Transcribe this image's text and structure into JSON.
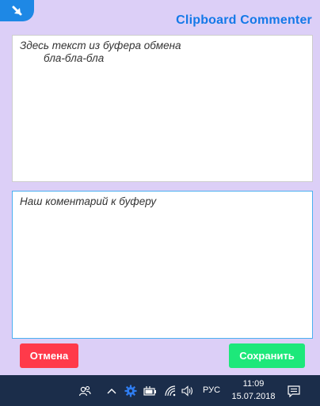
{
  "app": {
    "title": "Clipboard Commenter",
    "clipboard_text": "Здесь текст из буфера обмена\n        бла-бла-бла",
    "comment_text": "Наш коментарий к буферу",
    "cancel_label": "Отмена",
    "save_label": "Сохранить",
    "colors": {
      "accent": "#1479e8",
      "background": "#dccff7",
      "cancel": "#ff3a4a",
      "save": "#1de87a"
    }
  },
  "taskbar": {
    "language": "РУС",
    "time": "11:09",
    "date": "15.07.2018",
    "icons": [
      "people-icon",
      "chevron-up-icon",
      "gear-icon",
      "battery-icon",
      "wifi-icon",
      "volume-icon",
      "notification-icon"
    ]
  }
}
